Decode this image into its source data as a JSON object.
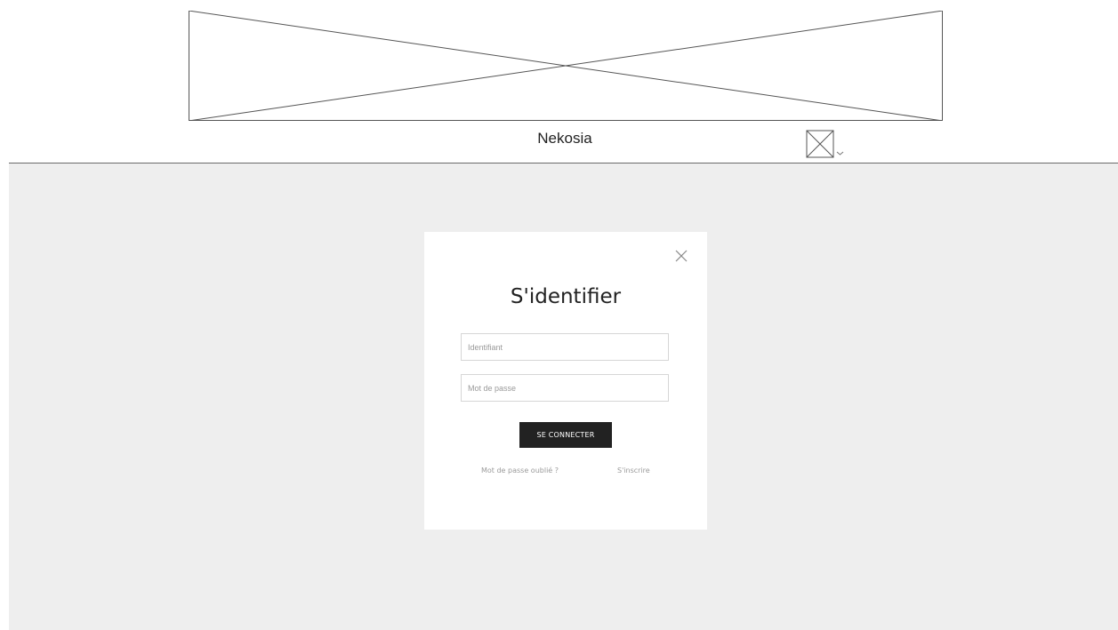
{
  "header": {
    "banner_icon": "image-placeholder",
    "brand_name": "Nekosia",
    "account_menu": {
      "icon": "image-placeholder",
      "chevron_icon": "chevron-down-icon"
    }
  },
  "login_modal": {
    "close_icon": "close-icon",
    "title": "S'identifier",
    "login_field": {
      "placeholder": "Identifiant",
      "value": ""
    },
    "password_field": {
      "placeholder": "Mot de passe",
      "value": ""
    },
    "submit_label": "SE CONNECTER",
    "forgot_password_label": "Mot de passe oublié ?",
    "register_label": "S'inscrire"
  },
  "colors": {
    "page_background": "#eeeeee",
    "button_background": "#222222",
    "link_text": "#9a9a9a"
  }
}
